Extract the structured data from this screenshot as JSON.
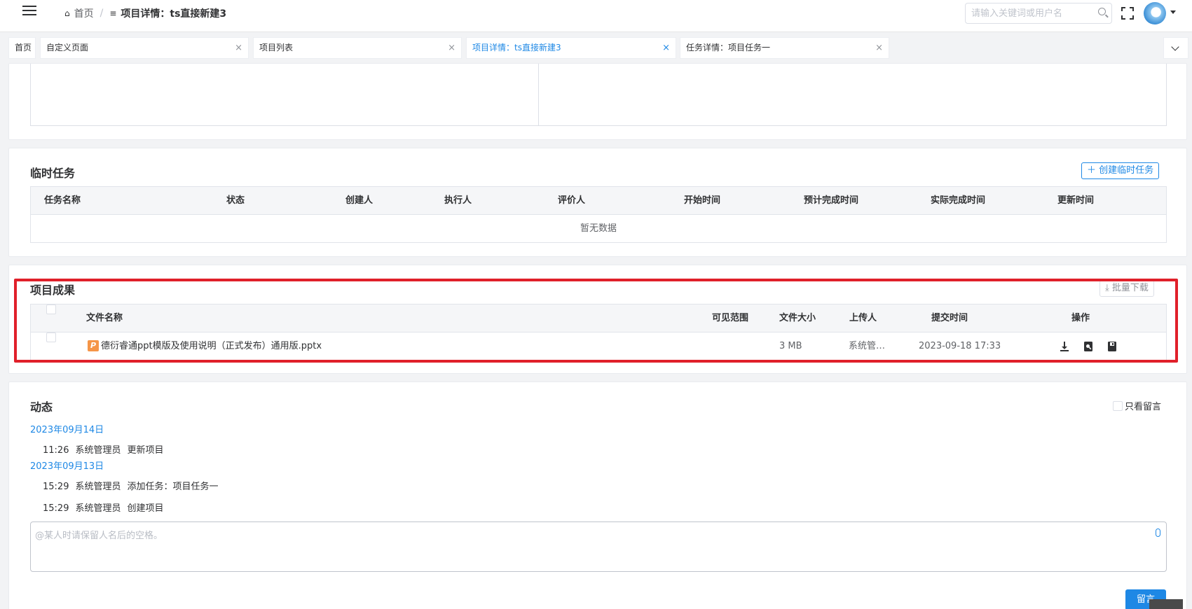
{
  "header": {
    "breadcrumb_home": "首页",
    "breadcrumb_current": "项目详情：ts直接新建3",
    "search_placeholder": "请输入关键词或用户名"
  },
  "tabs": [
    {
      "label": "首页",
      "closable": false
    },
    {
      "label": "自定义页面",
      "closable": true
    },
    {
      "label": "项目列表",
      "closable": true
    },
    {
      "label": "项目详情：ts直接新建3",
      "closable": true,
      "active": true
    },
    {
      "label": "任务详情：项目任务一",
      "closable": true
    }
  ],
  "temp_tasks": {
    "title": "临时任务",
    "create_button": "创建临时任务",
    "columns": [
      "任务名称",
      "状态",
      "创建人",
      "执行人",
      "评价人",
      "开始时间",
      "预计完成时间",
      "实际完成时间",
      "更新时间"
    ],
    "empty_text": "暂无数据"
  },
  "results": {
    "title": "项目成果",
    "batch_download": "批量下载",
    "columns": [
      "文件名称",
      "可见范围",
      "文件大小",
      "上传人",
      "提交时间",
      "操作"
    ],
    "rows": [
      {
        "file_icon": "P",
        "name": "德衍睿通ppt模版及使用说明（正式发布）通用版.pptx",
        "scope": "",
        "size": "3 MB",
        "uploader": "系统管…",
        "submitted": "2023-09-18 17:33"
      }
    ]
  },
  "activity": {
    "title": "动态",
    "only_comments": "只看留言",
    "groups": [
      {
        "date": "2023年09月14日",
        "entries": [
          {
            "time": "11:26",
            "user": "系统管理员",
            "action": "更新项目"
          }
        ]
      },
      {
        "date": "2023年09月13日",
        "entries": [
          {
            "time": "15:29",
            "user": "系统管理员",
            "action": "添加任务：项目任务一"
          },
          {
            "time": "15:29",
            "user": "系统管理员",
            "action": "创建项目"
          }
        ]
      }
    ],
    "comment_placeholder": "@某人时请保留人名后的空格。",
    "submit_label": "留言"
  },
  "colors": {
    "accent": "#1e88e5",
    "highlight": "#e0202a",
    "ppt_icon": "#f59547"
  },
  "icons": [
    "hamburger-icon",
    "home-icon",
    "filter-icon",
    "search-icon",
    "fullscreen-icon",
    "avatar",
    "chevron-down-icon",
    "close-icon",
    "plus-icon",
    "download-icon",
    "preview-icon",
    "save-icon",
    "paperclip-icon"
  ]
}
